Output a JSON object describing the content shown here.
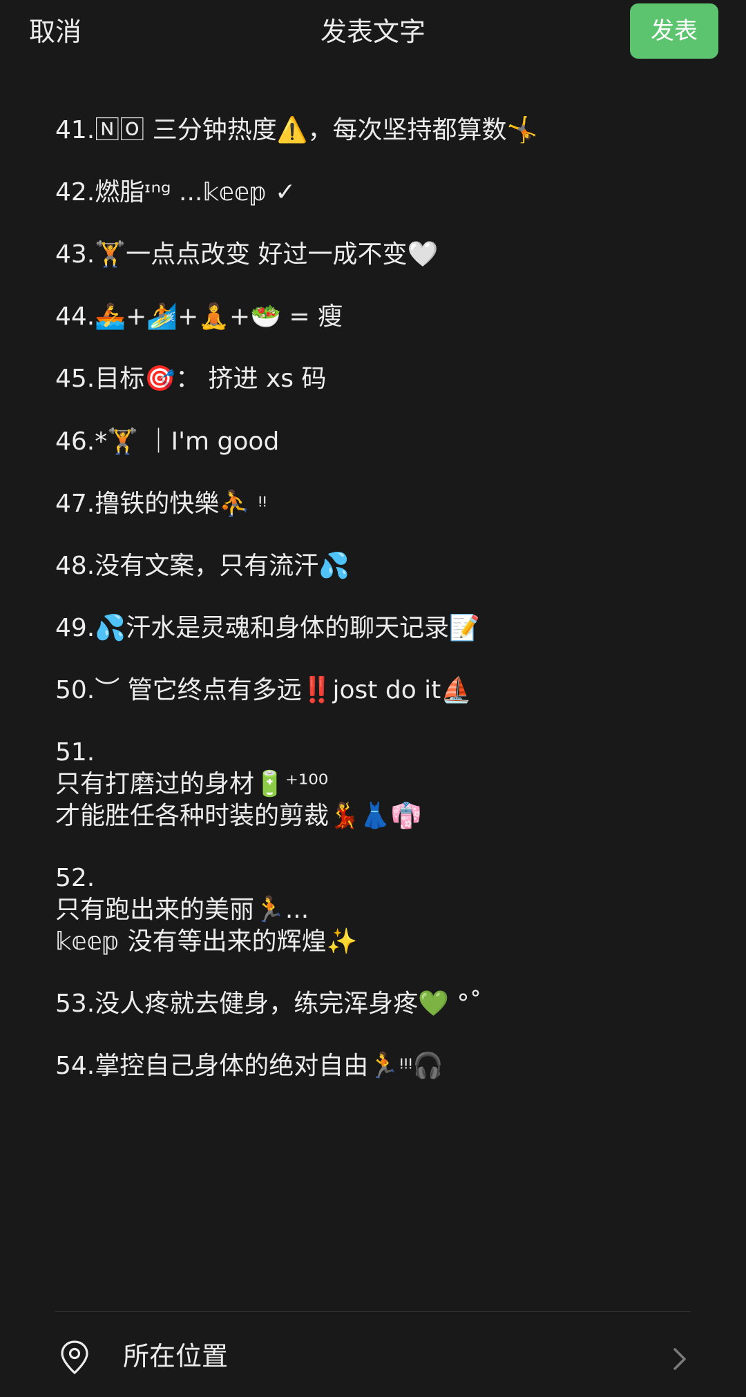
{
  "header": {
    "cancel_label": "取消",
    "title": "发表文字",
    "publish_label": "发表"
  },
  "post_lines": [
    "41.🄽🄾 三分钟热度⚠️，每次坚持都算数🤸",
    "42.燃脂ᶦⁿᵍ ...𝕜𝕖𝕖𝕡 ✓",
    "43.🏋️一点点改变 好过一成不变🤍",
    "44.🚣+🏄+🧘+🥗 = 瘦",
    "45.目标🎯： 挤进 xs 码",
    "46.*🏋️ ｜I'm good",
    "47.撸铁的快樂⛹️ ᵎᵎ",
    "48.没有文案，只有流汗💦",
    "49.💦汗水是灵魂和身体的聊天记录📝",
    "50.︶ 管它终点有多远‼️jost do it⛵",
    "51.",
    "只有打磨过的身材🔋⁺¹⁰⁰",
    "才能胜任各种时装的剪裁💃👗👘",
    "52.",
    "只有跑出来的美丽🏃...",
    "𝕜𝕖𝕖𝕡 没有等出来的辉煌✨",
    "53.没人疼就去健身，练完浑身疼💚 °˚",
    "54.掌控自己身体的绝对自由🏃ᵎᵎᵎ🎧"
  ],
  "location": {
    "label": "所在位置",
    "icon": "location-pin-icon",
    "chevron": "chevron-right-icon"
  },
  "colors": {
    "background": "#191919",
    "text": "#ececec",
    "accent": "#5cc36f"
  }
}
